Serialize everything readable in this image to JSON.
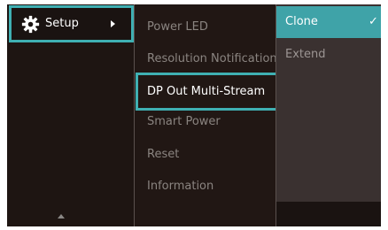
{
  "menu": {
    "setup": {
      "label": "Setup",
      "icon": "gear-icon"
    },
    "scroll_up_icon": "up-arrow-icon"
  },
  "submenu": {
    "items": [
      {
        "label": "Power LED",
        "selected": false
      },
      {
        "label": "Resolution Notification",
        "selected": false
      },
      {
        "label": "DP Out Multi-Stream",
        "selected": true
      },
      {
        "label": "Smart Power",
        "selected": false
      },
      {
        "label": "Reset",
        "selected": false
      },
      {
        "label": "Information",
        "selected": false
      }
    ]
  },
  "options": {
    "items": [
      {
        "label": "Clone",
        "selected": true,
        "check": "✓"
      },
      {
        "label": "Extend",
        "selected": false
      }
    ]
  },
  "colors": {
    "accent": "#3fb0b3",
    "selected_option_bg": "#3fa3a8",
    "panel_bg": "#1e1512",
    "options_bg": "#3a3130"
  }
}
